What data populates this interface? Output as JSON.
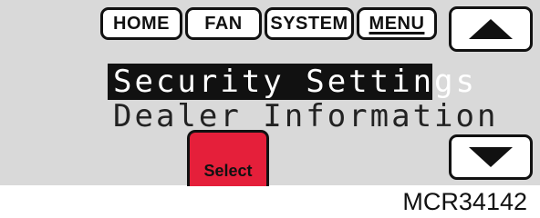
{
  "tabs": {
    "home": "HOME",
    "fan": "FAN",
    "system": "SYSTEM",
    "menu": "MENU"
  },
  "buttons": {
    "up": "up-arrow-icon",
    "down": "down-arrow-icon",
    "select": "Select"
  },
  "menu": {
    "selected": "Security Settings",
    "next": "Dealer Information"
  },
  "caption": "MCR34142",
  "colors": {
    "screen": "#d9d9d9",
    "select_button": "#e51f3a",
    "highlight": "#111111"
  }
}
